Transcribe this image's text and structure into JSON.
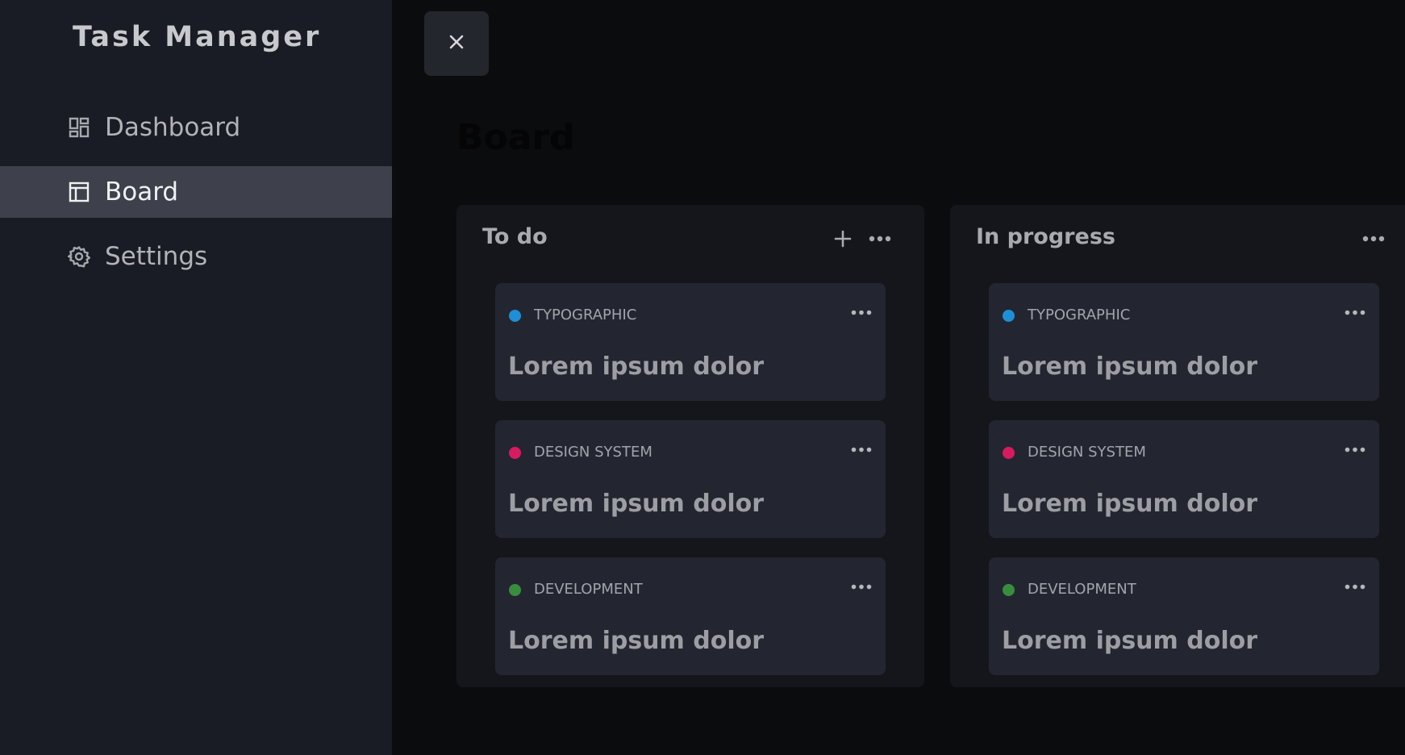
{
  "sidebar": {
    "title": "Task Manager",
    "items": [
      {
        "label": "Dashboard",
        "icon": "dashboard-icon",
        "active": false
      },
      {
        "label": "Board",
        "icon": "board-icon",
        "active": true
      },
      {
        "label": "Settings",
        "icon": "gear-icon",
        "active": false
      }
    ]
  },
  "main": {
    "close_icon": "close-icon",
    "title": "Board",
    "columns": [
      {
        "title": "To do",
        "has_add": true,
        "cards": [
          {
            "tag": "TYPOGRAPHIC",
            "tag_color": "#1e8fd6",
            "title": "Lorem ipsum dolor"
          },
          {
            "tag": "DESIGN SYSTEM",
            "tag_color": "#d81b60",
            "title": "Lorem ipsum dolor"
          },
          {
            "tag": "DEVELOPMENT",
            "tag_color": "#388e3c",
            "title": "Lorem ipsum dolor"
          }
        ]
      },
      {
        "title": "In progress",
        "has_add": false,
        "cards": [
          {
            "tag": "TYPOGRAPHIC",
            "tag_color": "#1e8fd6",
            "title": "Lorem ipsum dolor"
          },
          {
            "tag": "DESIGN SYSTEM",
            "tag_color": "#d81b60",
            "title": "Lorem ipsum dolor"
          },
          {
            "tag": "DEVELOPMENT",
            "tag_color": "#388e3c",
            "title": "Lorem ipsum dolor"
          }
        ]
      }
    ]
  },
  "colors": {
    "sidebar_bg": "#191c24",
    "active_item_bg": "#3e414b",
    "main_bg": "#0b0c0e",
    "column_bg": "#14161b",
    "card_bg": "#232631"
  }
}
